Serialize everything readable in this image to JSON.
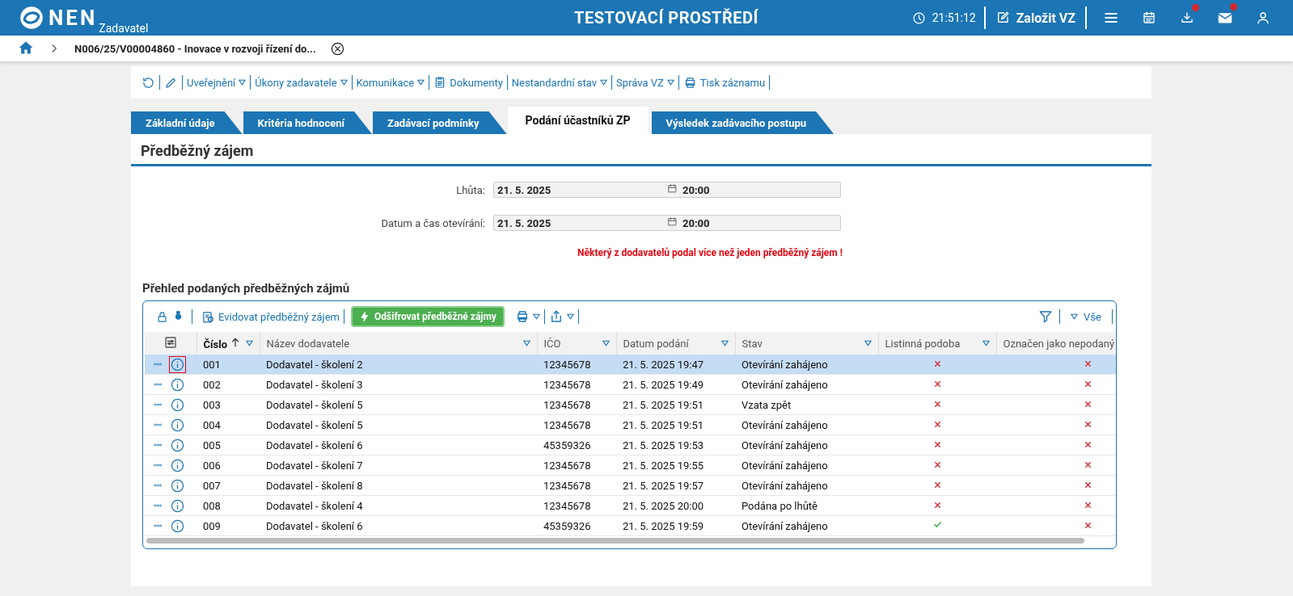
{
  "header": {
    "logo": "NEN",
    "role": "Zadavatel",
    "environment": "TESTOVACÍ PROSTŘEDÍ",
    "time": "21:51:12",
    "create_button": "Založit VZ",
    "notifications": [
      {
        "kind": "menu",
        "badge": false
      },
      {
        "kind": "calendar",
        "badge": false
      },
      {
        "kind": "download",
        "badge": true
      },
      {
        "kind": "mail",
        "badge": true
      },
      {
        "kind": "user",
        "badge": false
      }
    ]
  },
  "breadcrumb": {
    "title": "N006/25/V00004860 - Inovace v rozvoji řízení do..."
  },
  "toolbar": [
    {
      "kind": "refresh"
    },
    {
      "kind": "edit"
    },
    {
      "kind": "menu",
      "label": "Uveřejnění"
    },
    {
      "kind": "menu",
      "label": "Úkony zadavatele"
    },
    {
      "kind": "menu",
      "label": "Komunikace"
    },
    {
      "kind": "doc",
      "label": "Dokumenty"
    },
    {
      "kind": "menu",
      "label": "Nestandardní stav"
    },
    {
      "kind": "menu",
      "label": "Správa VZ"
    },
    {
      "kind": "print",
      "label": "Tisk záznamu"
    }
  ],
  "tabs": [
    {
      "label": "Základní údaje",
      "selected": false
    },
    {
      "label": "Kritéria hodnocení",
      "selected": false
    },
    {
      "label": "Zadávací podmínky",
      "selected": false
    },
    {
      "label": "Podání účastníků ZP",
      "selected": true
    },
    {
      "label": "Výsledek zadávacího postupu",
      "selected": false
    }
  ],
  "section_title": "Předběžný zájem",
  "fields": [
    {
      "label": "Lhůta:",
      "date": "21. 5. 2025",
      "time": "20:00"
    },
    {
      "label": "Datum a čas otevírání:",
      "date": "21. 5. 2025",
      "time": "20:00"
    }
  ],
  "warning": "Některý z dodavatelů podal více než jeden předběžný zájem !",
  "table_title": "Přehled podaných předběžných zájmů",
  "table_toolbar": {
    "register": "Evidovat předběžný zájem",
    "decrypt": "Odšifrovat předběžné zájmy",
    "filter_all": "Vše"
  },
  "columns": [
    {
      "label": "Číslo",
      "sorted": true
    },
    {
      "label": "Název dodavatele",
      "sorted": false
    },
    {
      "label": "IČO",
      "sorted": false
    },
    {
      "label": "Datum podání",
      "sorted": false
    },
    {
      "label": "Stav",
      "sorted": false
    },
    {
      "label": "Listinná podoba",
      "sorted": false
    },
    {
      "label": "Označen jako nepodaný",
      "sorted": false
    }
  ],
  "rows": [
    {
      "number": "001",
      "supplier": "Dodavatel - školení 2",
      "ico": "12345678",
      "date": "21. 5. 2025 19:47",
      "state": "Otevírání zahájeno",
      "paper": false,
      "unsubmitted": false,
      "selected": true
    },
    {
      "number": "002",
      "supplier": "Dodavatel - školení 3",
      "ico": "12345678",
      "date": "21. 5. 2025 19:49",
      "state": "Otevírání zahájeno",
      "paper": false,
      "unsubmitted": false,
      "selected": false
    },
    {
      "number": "003",
      "supplier": "Dodavatel - školení 5",
      "ico": "12345678",
      "date": "21. 5. 2025 19:51",
      "state": "Vzata zpět",
      "paper": false,
      "unsubmitted": false,
      "selected": false
    },
    {
      "number": "004",
      "supplier": "Dodavatel - školení 5",
      "ico": "12345678",
      "date": "21. 5. 2025 19:51",
      "state": "Otevírání zahájeno",
      "paper": false,
      "unsubmitted": false,
      "selected": false
    },
    {
      "number": "005",
      "supplier": "Dodavatel - školení 6",
      "ico": "45359326",
      "date": "21. 5. 2025 19:53",
      "state": "Otevírání zahájeno",
      "paper": false,
      "unsubmitted": false,
      "selected": false
    },
    {
      "number": "006",
      "supplier": "Dodavatel - školení 7",
      "ico": "12345678",
      "date": "21. 5. 2025 19:55",
      "state": "Otevírání zahájeno",
      "paper": false,
      "unsubmitted": false,
      "selected": false
    },
    {
      "number": "007",
      "supplier": "Dodavatel - školení 8",
      "ico": "12345678",
      "date": "21. 5. 2025 19:57",
      "state": "Otevírání zahájeno",
      "paper": false,
      "unsubmitted": false,
      "selected": false
    },
    {
      "number": "008",
      "supplier": "Dodavatel - školení 4",
      "ico": "12345678",
      "date": "21. 5. 2025 20:00",
      "state": "Podána po lhůtě",
      "paper": false,
      "unsubmitted": false,
      "selected": false
    },
    {
      "number": "009",
      "supplier": "Dodavatel - školení 6",
      "ico": "45359326",
      "date": "21. 5. 2025 19:59",
      "state": "Otevírání zahájeno",
      "paper": true,
      "unsubmitted": false,
      "selected": false
    }
  ]
}
